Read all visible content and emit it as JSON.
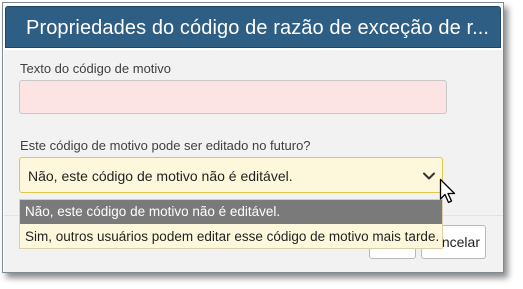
{
  "dialog": {
    "title": "Propriedades do código de razão de exceção de r...",
    "reason_text_label": "Texto do código de motivo",
    "reason_text_value": "",
    "editable_label": "Este código de motivo pode ser editado no futuro?",
    "editable_select": {
      "selected": "Não, este código de motivo não é editável.",
      "options": [
        "Não, este código de motivo não é editável.",
        "Sim, outros usuários podem editar esse código de motivo mais tarde."
      ]
    },
    "buttons": {
      "ok_label": "",
      "cancel_label": "ancelar"
    }
  },
  "colors": {
    "titlebar": "#2e5e84",
    "required_field_bg": "#fbe4e3",
    "select_bg": "#fdf8dc",
    "select_border": "#e2c649",
    "highlight_option_bg": "#7a7a7a"
  },
  "icons": {
    "select_arrow": "chevron-down-icon",
    "pointer": "mouse-cursor-icon"
  }
}
